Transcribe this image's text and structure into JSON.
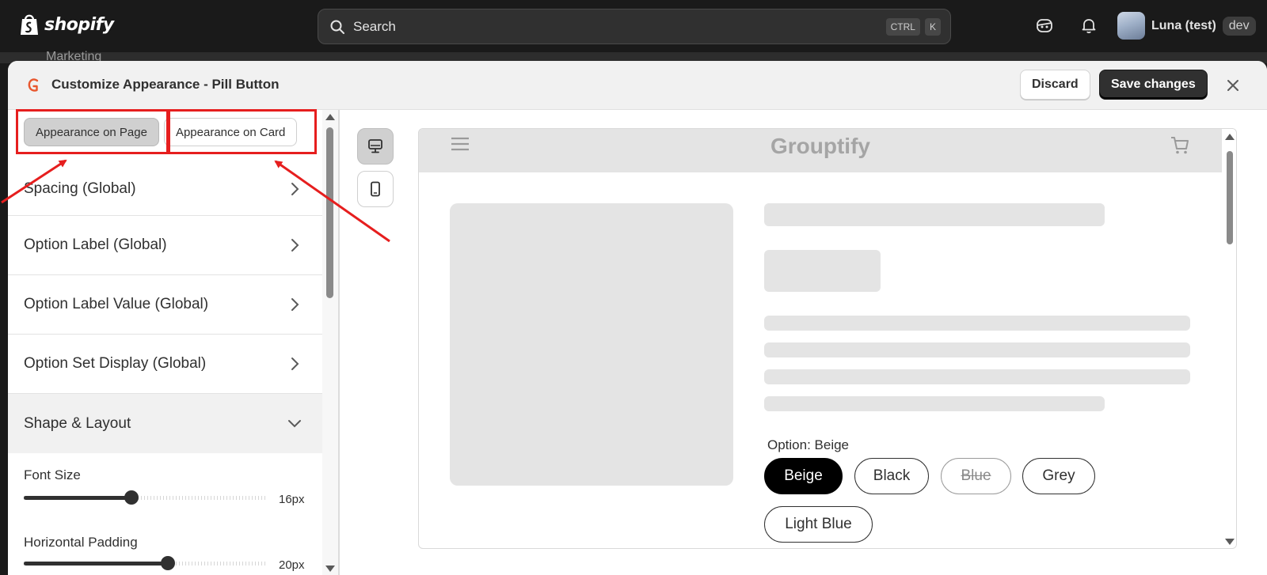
{
  "topbar": {
    "brand": "shopify",
    "search": {
      "placeholder": "Search",
      "shortcut_keys": [
        "CTRL",
        "K"
      ]
    },
    "icons": [
      "shopify-bag-icon",
      "search-icon",
      "ai-assistant-icon",
      "bell-icon"
    ],
    "account": {
      "name": "Luna (test)",
      "badge": "dev"
    }
  },
  "background": {
    "nav_item": "Marketing"
  },
  "modal": {
    "title": "Customize Appearance - Pill Button",
    "discard_label": "Discard",
    "save_label": "Save changes",
    "close_icon": "close-icon"
  },
  "left_panel": {
    "tabs": [
      {
        "label": "Appearance on Page",
        "active": true
      },
      {
        "label": "Appearance on Card",
        "active": false
      }
    ],
    "sections": [
      {
        "label": "Spacing (Global)",
        "state": "collapsed"
      },
      {
        "label": "Option Label (Global)",
        "state": "collapsed"
      },
      {
        "label": "Option Label Value (Global)",
        "state": "collapsed"
      },
      {
        "label": "Option Set Display (Global)",
        "state": "collapsed"
      },
      {
        "label": "Shape & Layout",
        "state": "expanded"
      }
    ],
    "sliders": [
      {
        "label": "Font Size",
        "value": "16px",
        "level": 0.44
      },
      {
        "label": "Horizontal Padding",
        "value": "20px",
        "level": 0.59
      }
    ]
  },
  "preview": {
    "devices": [
      {
        "name": "desktop",
        "active": true
      },
      {
        "name": "mobile",
        "active": false
      }
    ],
    "store_name": "Grouptify",
    "option_label": "Option: Beige",
    "options": [
      {
        "label": "Beige",
        "state": "selected"
      },
      {
        "label": "Black",
        "state": "available"
      },
      {
        "label": "Blue",
        "state": "unavailable"
      },
      {
        "label": "Grey",
        "state": "available"
      },
      {
        "label": "Light Blue",
        "state": "available"
      }
    ]
  },
  "colors": {
    "topbar_bg": "#1a1a1a",
    "annotation_red": "#e61e1e",
    "save_button_bg": "#303030",
    "app_logo": "#e8572e",
    "selected_option_bg": "#000000"
  }
}
